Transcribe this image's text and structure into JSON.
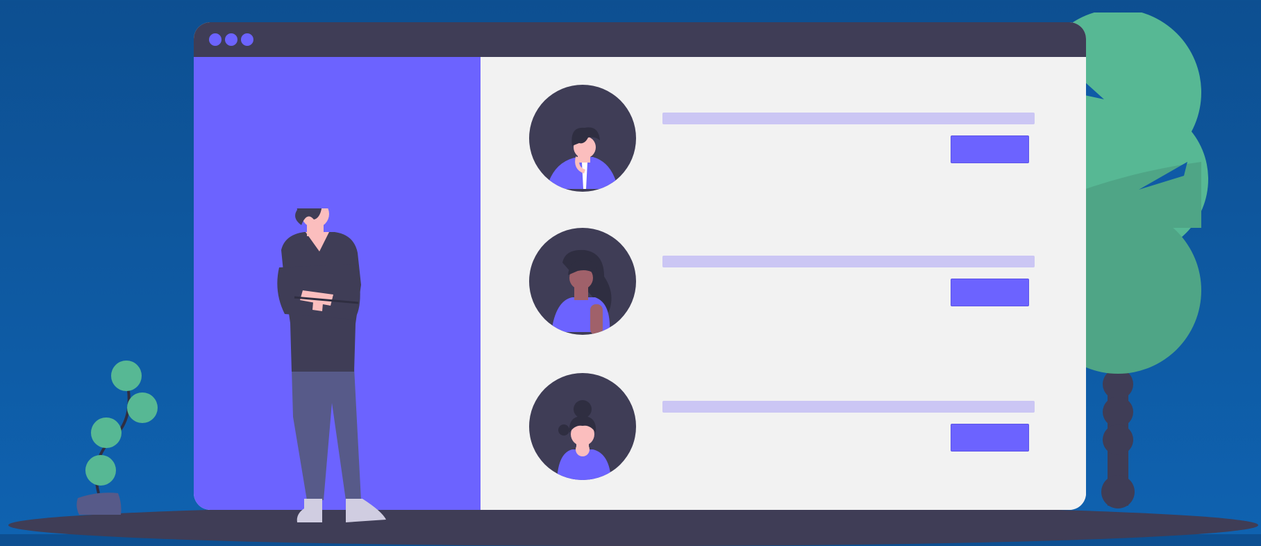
{
  "scene": {
    "background_color": "#0f5aa6",
    "accent_color": "#6c63ff",
    "dark_color": "#3f3d56",
    "leaf_color": "#57b894"
  },
  "window": {
    "titlebar_dots": [
      "circle",
      "circle",
      "circle"
    ],
    "rows": [
      {
        "avatar": "man-avatar-icon",
        "button_label": ""
      },
      {
        "avatar": "woman-long-hair-avatar-icon",
        "button_label": ""
      },
      {
        "avatar": "woman-bun-avatar-icon",
        "button_label": ""
      }
    ]
  },
  "illustrations": [
    "standing-man",
    "potted-plant",
    "tree"
  ]
}
